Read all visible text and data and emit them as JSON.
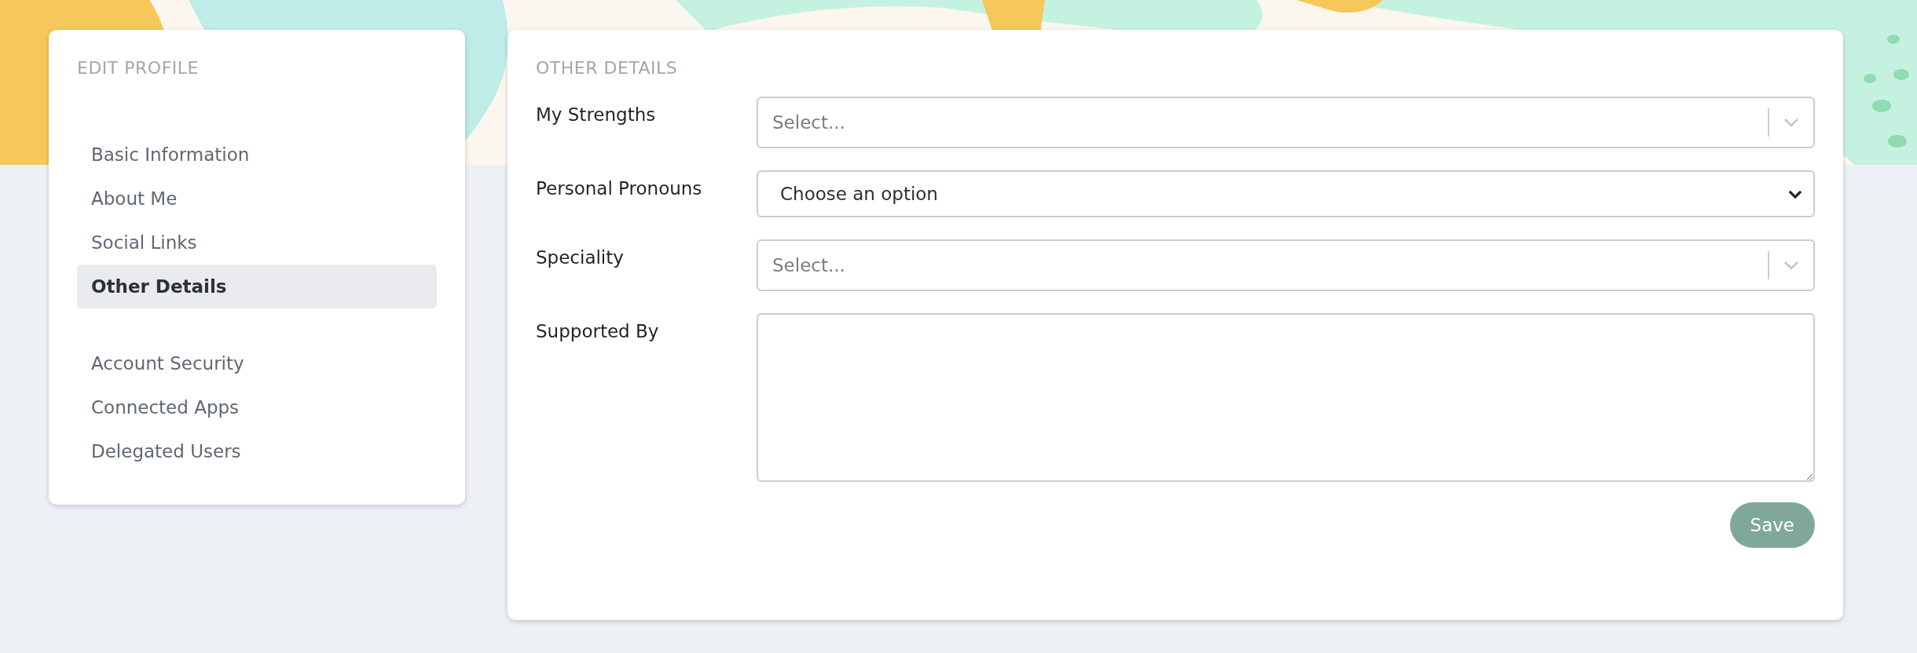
{
  "sidebar": {
    "title": "EDIT PROFILE",
    "groups": [
      [
        {
          "label": "Basic Information",
          "selected": false
        },
        {
          "label": "About Me",
          "selected": false
        },
        {
          "label": "Social Links",
          "selected": false
        },
        {
          "label": "Other Details",
          "selected": true
        }
      ],
      [
        {
          "label": "Account Security",
          "selected": false
        },
        {
          "label": "Connected Apps",
          "selected": false
        },
        {
          "label": "Delegated Users",
          "selected": false
        }
      ]
    ]
  },
  "form": {
    "title": "OTHER DETAILS",
    "fields": [
      {
        "label": "My Strengths",
        "kind": "multiselect",
        "placeholder": "Select..."
      },
      {
        "label": "Personal Pronouns",
        "kind": "dropdown",
        "value": "Choose an option"
      },
      {
        "label": "Speciality",
        "kind": "multiselect",
        "placeholder": "Select..."
      },
      {
        "label": "Supported By",
        "kind": "textarea"
      }
    ],
    "save_button": "Save"
  }
}
